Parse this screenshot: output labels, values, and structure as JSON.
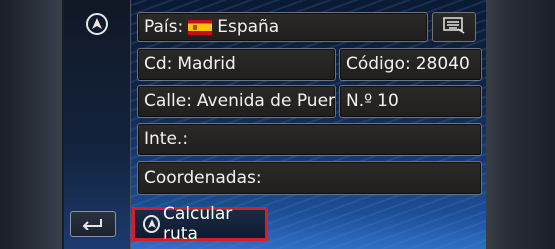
{
  "form": {
    "country_label": "País:",
    "country_value": "España",
    "city_label": "Cd:",
    "city_value": "Madrid",
    "postal_label": "Código:",
    "postal_value": "28040",
    "street_label": "Calle:",
    "street_value": "Avenida de Puer...",
    "number_label": "N.º",
    "number_value": "10",
    "intersection_label": "Inte.:",
    "coordinates_label": "Coordenadas:"
  },
  "actions": {
    "calculate_route_label": "Calcular ruta"
  },
  "icons": {
    "top_left": "navigation-arrow-icon",
    "keyboard": "keyboard-icon",
    "back": "back-arrow-icon",
    "flag": "spain-flag-icon"
  },
  "colors": {
    "highlight": "#d0202a",
    "field_bg": "#2a2826",
    "screen_blue": "#1c4d96"
  }
}
